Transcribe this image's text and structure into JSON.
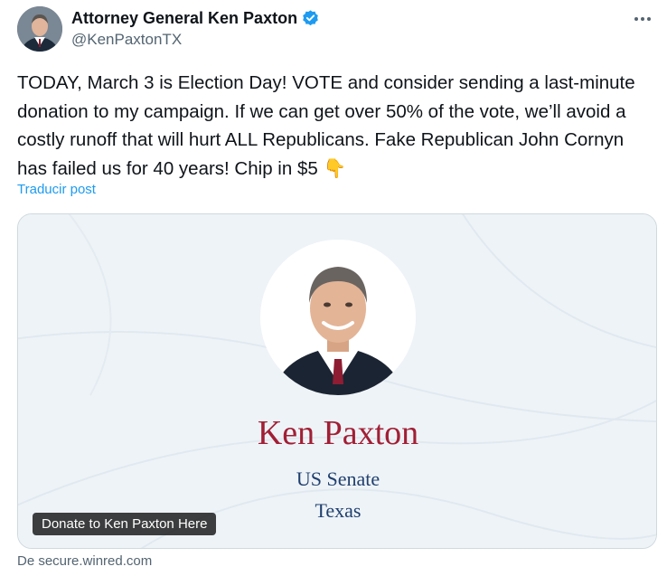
{
  "author": {
    "display_name": "Attorney General Ken Paxton",
    "handle": "@KenPaxtonTX",
    "verified_icon": "verified-badge-icon",
    "avatar_icon": "avatar"
  },
  "post": {
    "text": "TODAY, March 3 is Election Day! VOTE and consider sending a last-minute donation to my campaign. If we can get over 50% of the vote, we’ll avoid a costly runoff that will hurt ALL Republicans. Fake Republican John Cornyn has failed us for 40 years! Chip in $5 👇",
    "translate_label": "Traducir post"
  },
  "card": {
    "name": "Ken Paxton",
    "office": "US Senate",
    "state": "Texas",
    "link_label": "Donate to Ken Paxton Here",
    "source": "De secure.winred.com"
  },
  "colors": {
    "accent": "#1d9bf0",
    "card_name": "#a11f35",
    "card_office": "#1f3f6e"
  }
}
